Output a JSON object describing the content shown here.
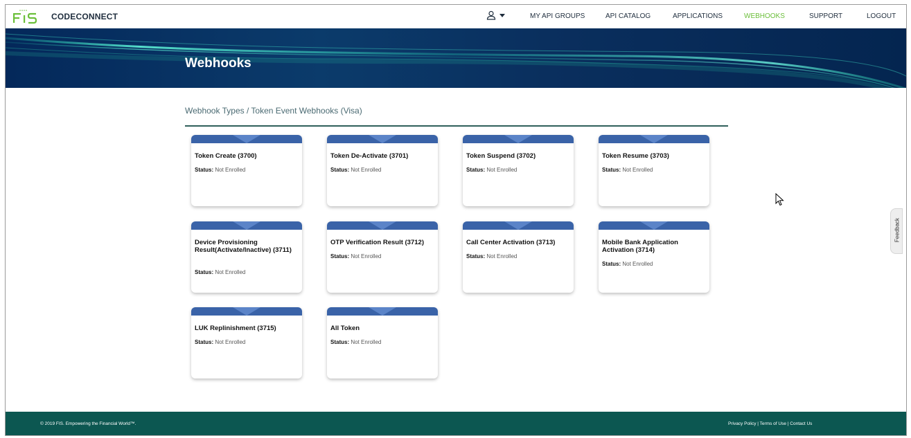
{
  "brand": "CODECONNECT",
  "nav": {
    "items": [
      "MY API GROUPS",
      "API CATALOG",
      "APPLICATIONS",
      "WEBHOOKS",
      "SUPPORT",
      "LOGOUT"
    ],
    "active": "WEBHOOKS",
    "user_icon": "user-icon"
  },
  "hero": {
    "title": "Webhooks"
  },
  "breadcrumb": "Webhook Types / Token Event Webhooks (Visa)",
  "status_label": "Status:",
  "cards": [
    {
      "title": "Token Create (3700)",
      "status": "Not Enrolled"
    },
    {
      "title": "Token De-Activate (3701)",
      "status": "Not Enrolled"
    },
    {
      "title": "Token Suspend (3702)",
      "status": "Not Enrolled"
    },
    {
      "title": "Token Resume (3703)",
      "status": "Not Enrolled"
    },
    {
      "title": "Device Provisioning Result(Activate/Inactive) (3711)",
      "status": "Not Enrolled"
    },
    {
      "title": "OTP Verification Result (3712)",
      "status": "Not Enrolled"
    },
    {
      "title": "Call Center Activation (3713)",
      "status": "Not Enrolled"
    },
    {
      "title": "Mobile Bank Application Activation (3714)",
      "status": "Not Enrolled"
    },
    {
      "title": "LUK Replinishment (3715)",
      "status": "Not Enrolled"
    },
    {
      "title": "All Token",
      "status": "Not Enrolled"
    }
  ],
  "feedback": "Feedback",
  "footer": {
    "copyright": "© 2019 FIS. Empowering the Financial World™.",
    "links": [
      "Privacy Policy",
      "Terms of Use",
      "Contact Us"
    ]
  },
  "colors": {
    "accent_green": "#6bbf3a",
    "card_band": "#3a63a8",
    "footer": "#0c5751",
    "rule": "#2f5f5a"
  }
}
